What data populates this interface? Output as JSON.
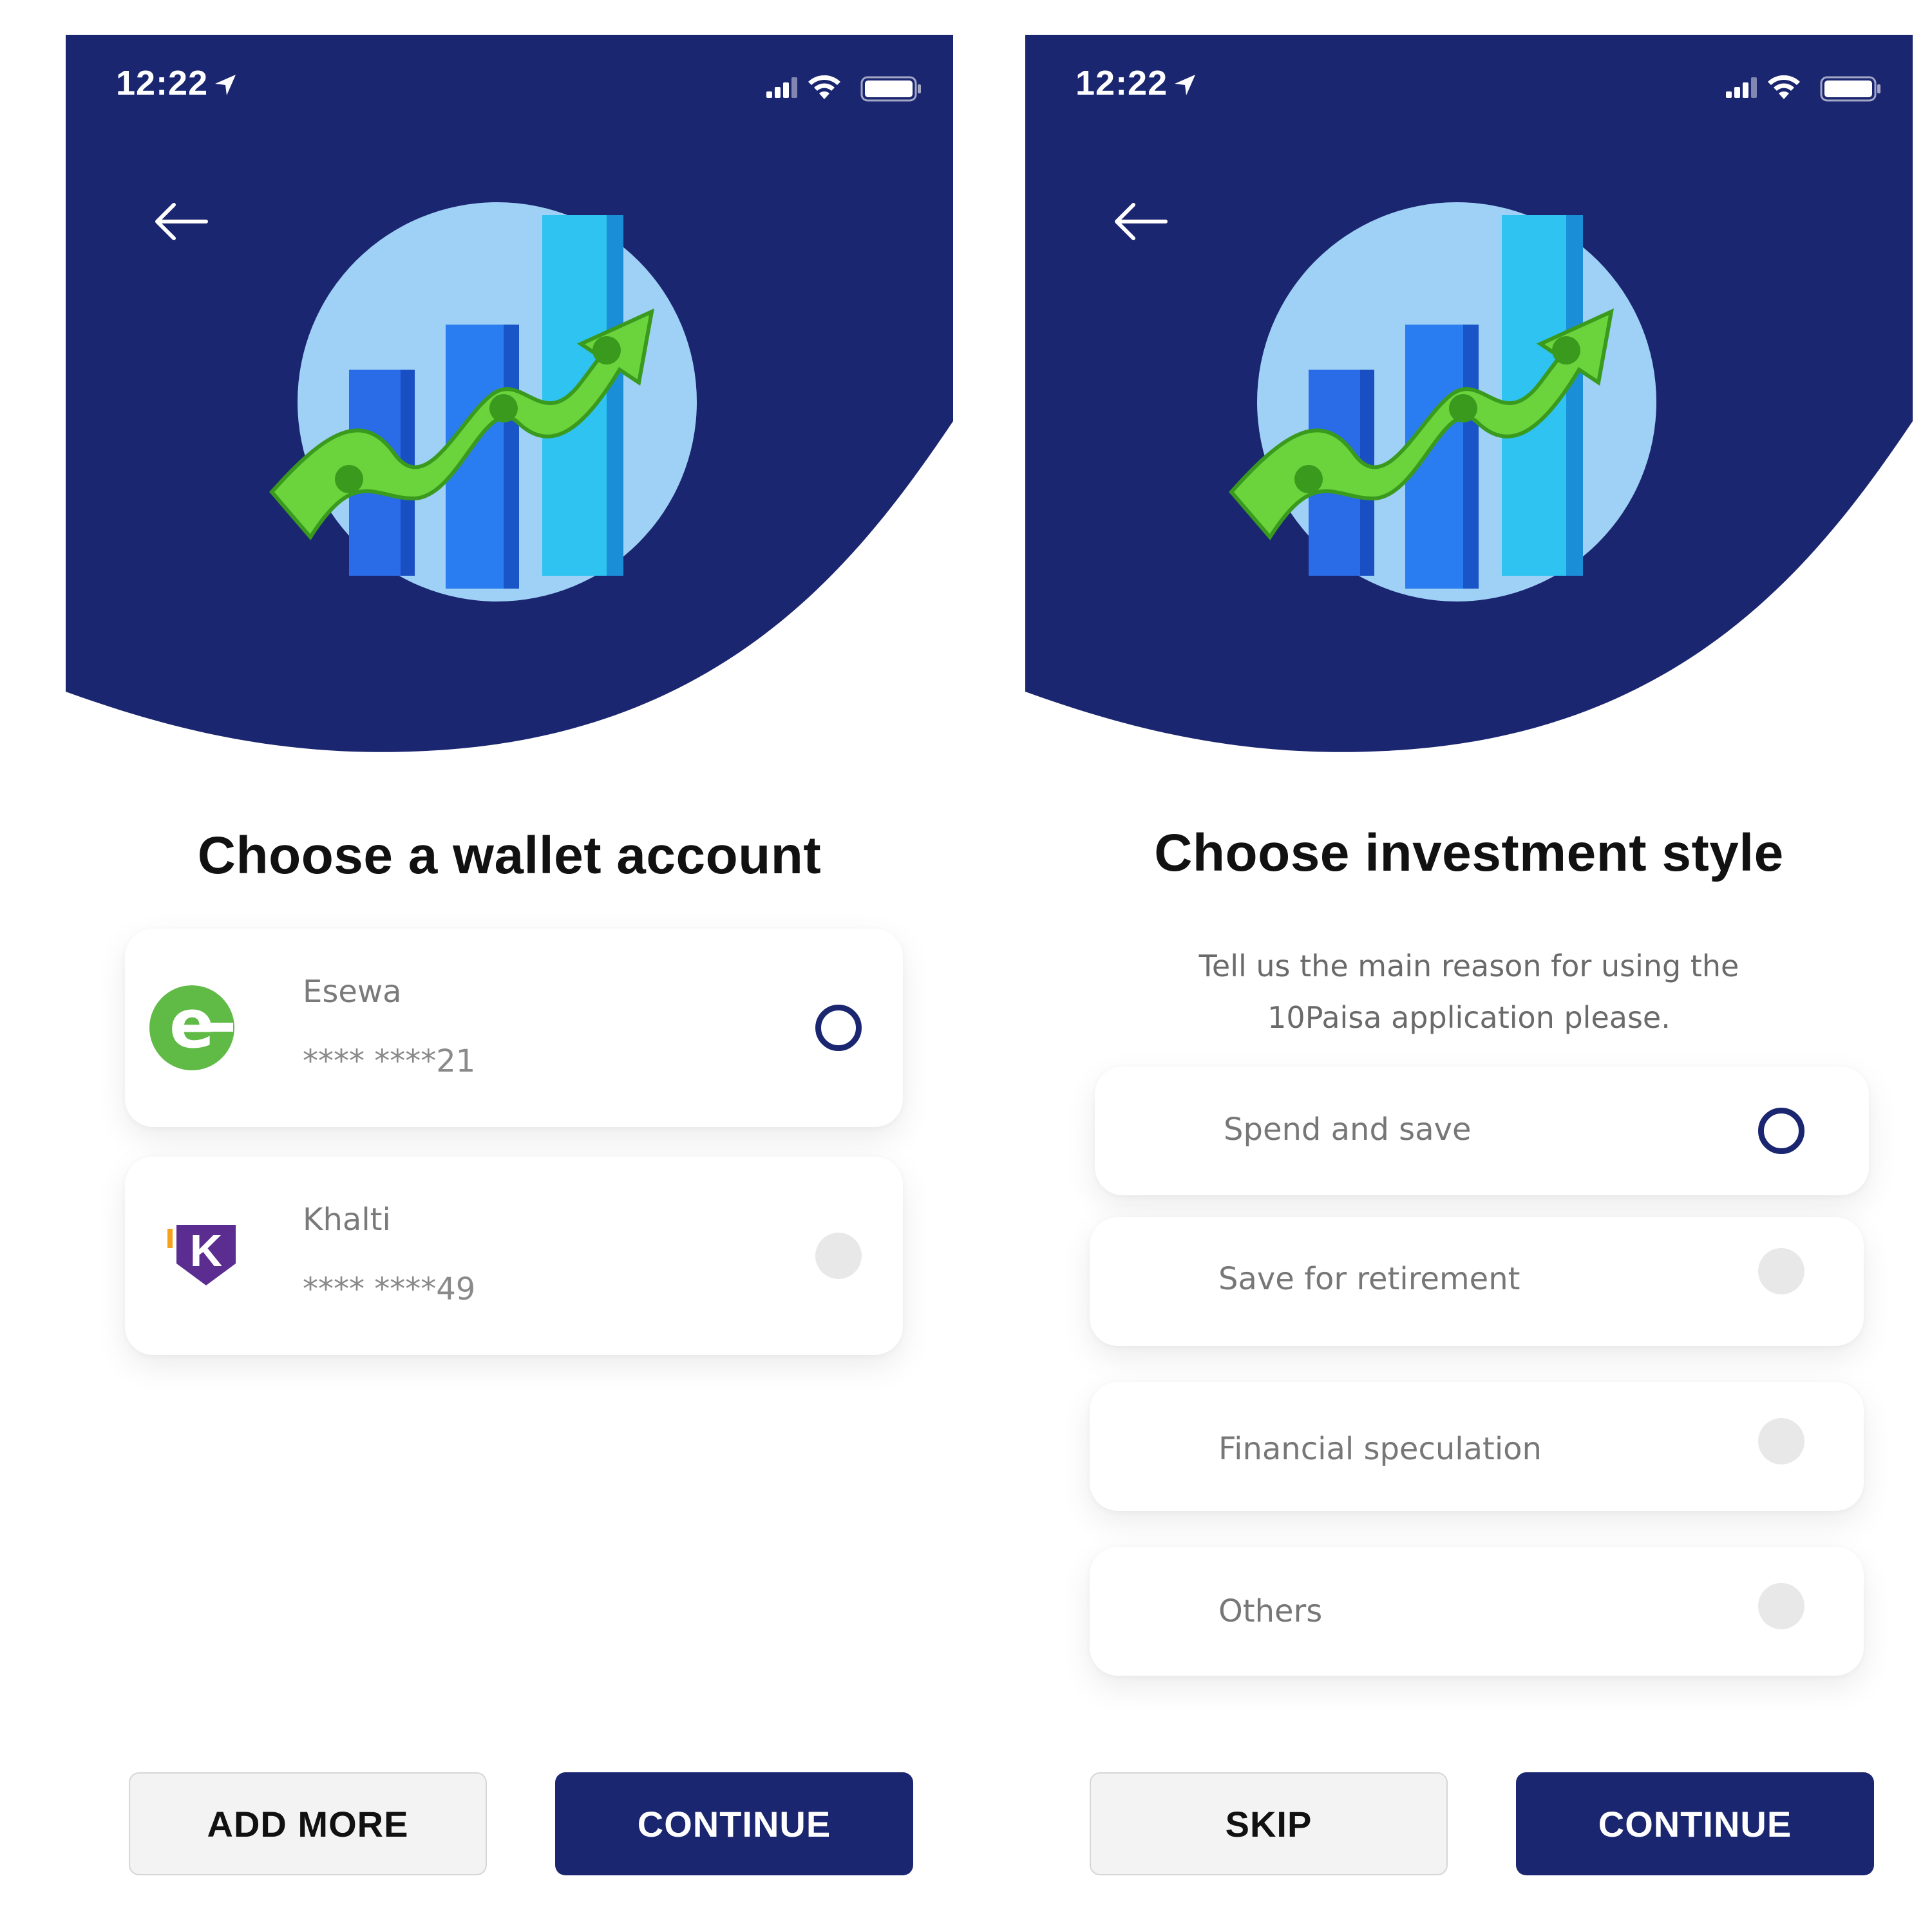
{
  "colors": {
    "navy": "#1b2670",
    "secondary_button": "#f3f3f3",
    "radio_off": "#e8e8e8",
    "text_dark": "#111111",
    "text_muted": "#777777"
  },
  "status_bar": {
    "time": "12:22",
    "icons": [
      "location-arrow-icon",
      "cellular-signal-icon",
      "wifi-icon",
      "battery-icon"
    ]
  },
  "screen_wallet": {
    "back_icon": "arrow-left-icon",
    "illustration": "growth-chart-money-illustration",
    "title": "Choose a wallet account",
    "wallets": [
      {
        "name": "Esewa",
        "masked_number": "**** ****21",
        "logo": "esewa-logo",
        "selected": true
      },
      {
        "name": "Khalti",
        "masked_number": "**** ****49",
        "logo": "khalti-logo",
        "selected": false
      }
    ],
    "buttons": {
      "secondary": "ADD MORE",
      "primary": "CONTINUE"
    }
  },
  "screen_investment": {
    "back_icon": "arrow-left-icon",
    "illustration": "growth-chart-money-illustration",
    "title": "Choose investment style",
    "subtitle_line1": "Tell us the main reason for using the",
    "subtitle_line2": "10Paisa application please.",
    "options": [
      {
        "label": "Spend and save",
        "selected": true
      },
      {
        "label": "Save for retirement",
        "selected": false
      },
      {
        "label": "Financial speculation",
        "selected": false
      },
      {
        "label": "Others",
        "selected": false
      }
    ],
    "buttons": {
      "secondary": "SKIP",
      "primary": "CONTINUE"
    }
  }
}
